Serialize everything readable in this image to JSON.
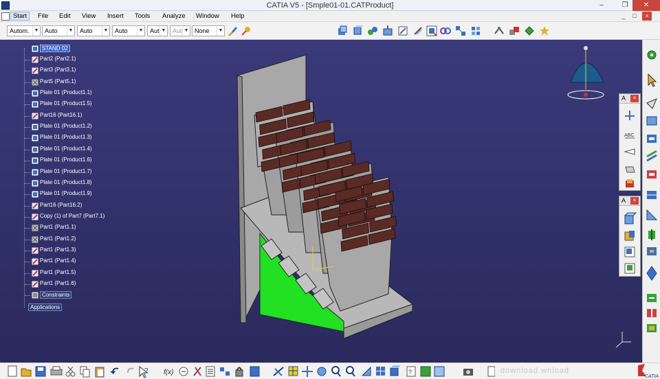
{
  "window": {
    "title": "CATIA V5 - [Smple01-01.CATProduct]",
    "min_glyph": "–",
    "restore_glyph": "❐",
    "close_glyph": "✕"
  },
  "menu": {
    "items": [
      "Start",
      "File",
      "Edit",
      "View",
      "Insert",
      "Tools",
      "Analyze",
      "Window",
      "Help"
    ],
    "mdi_min": "_",
    "mdi_restore": "□",
    "mdi_close": "×"
  },
  "toolbar1": {
    "combos": [
      "Autom.",
      "Auto",
      "Auto",
      "Auto",
      "Aut",
      "Aut",
      "None"
    ],
    "icons": [
      "paint-brush-icon",
      "apply-material-icon",
      "bill-of-material-icon",
      "rotate-component-icon",
      "cut-section-icon",
      "measure-icon",
      "constraint-icon",
      "snap-icon",
      "explode-icon",
      "clash-icon",
      "fix-icon",
      "manipulate-icon",
      "analysis-icon",
      "scenes-icon"
    ]
  },
  "tree": {
    "root": "STAND 02",
    "nodes": [
      {
        "label": "Part2 (Part2.1)",
        "icon": "part-icon"
      },
      {
        "label": "Part3 (Part3.1)",
        "icon": "part-icon"
      },
      {
        "label": "Part5 (Part5.1)",
        "icon": "part-hidden-icon"
      },
      {
        "label": "Plate 01 (Product1.1)",
        "icon": "product-icon"
      },
      {
        "label": "Plate 01 (Product1.5)",
        "icon": "product-icon"
      },
      {
        "label": "Part16 (Part16.1)",
        "icon": "part-icon"
      },
      {
        "label": "Plate 01 (Product1.2)",
        "icon": "product-icon"
      },
      {
        "label": "Plate 01 (Product1.3)",
        "icon": "product-icon"
      },
      {
        "label": "Plate 01 (Product1.4)",
        "icon": "product-icon"
      },
      {
        "label": "Plate 01 (Product1.6)",
        "icon": "product-icon"
      },
      {
        "label": "Plate 01 (Product1.7)",
        "icon": "product-icon"
      },
      {
        "label": "Plate 01 (Product1.8)",
        "icon": "product-icon"
      },
      {
        "label": "Plate 01 (Product1.9)",
        "icon": "product-icon"
      },
      {
        "label": "Part16 (Part16.2)",
        "icon": "part-icon"
      },
      {
        "label": "Copy (1) of Part7 (Part7.1)",
        "icon": "part-icon"
      },
      {
        "label": "Part1 (Part1.1)",
        "icon": "part-hidden-icon"
      },
      {
        "label": "Part1 (Part1.2)",
        "icon": "part-hidden-icon"
      },
      {
        "label": "Part1 (Part1.3)",
        "icon": "part-icon"
      },
      {
        "label": "Part1 (Part1.4)",
        "icon": "part-icon"
      },
      {
        "label": "Part1 (Part1.5)",
        "icon": "part-icon"
      },
      {
        "label": "Part1 (Part1.6)",
        "icon": "part-icon"
      },
      {
        "label": "Constraints",
        "icon": "constraints-icon"
      }
    ],
    "applications": "Applications"
  },
  "palettes": {
    "palette1_title": "A",
    "palette2_title": "A",
    "close_glyph": "×"
  },
  "bottombar": {
    "formula_label": "f(x)",
    "help_label": "?",
    "watermark": "download   wnload"
  },
  "colors": {
    "background": "#2f2f66",
    "plate": "#9c9c9c",
    "tile": "#5a2a25",
    "green_panel": "#22e022",
    "compass_blue": "#1e5a8c"
  }
}
